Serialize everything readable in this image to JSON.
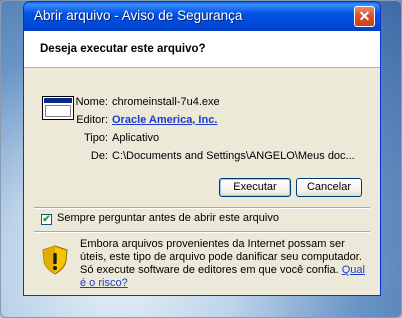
{
  "window": {
    "title": "Abrir arquivo - Aviso de Segurança",
    "close_symbol": "✕"
  },
  "header": {
    "question": "Deseja executar este arquivo?"
  },
  "file_info": {
    "icon": "application-window-icon",
    "name_label": "Nome:",
    "name_value": "chromeinstall-7u4.exe",
    "publisher_label": "Editor:",
    "publisher_value": "Oracle America, Inc.",
    "type_label": "Tipo:",
    "type_value": "Aplicativo",
    "from_label": "De:",
    "from_value": "C:\\Documents and Settings\\ANGELO\\Meus doc..."
  },
  "buttons": {
    "run_label": "Executar",
    "cancel_label": "Cancelar"
  },
  "checkbox": {
    "label": "Sempre perguntar antes de abrir este arquivo",
    "checked": true,
    "check_symbol": "✔"
  },
  "warning": {
    "icon": "security-shield-warning-icon",
    "text": "Embora arquivos provenientes da Internet possam ser úteis, este tipo de arquivo pode danificar seu computador. Só execute software de editores em que você confia.",
    "risk_link": "Qual é o risco?"
  },
  "colors": {
    "titlebar": "#0054e3",
    "dialog_bg": "#ece9d8",
    "link": "#1f3cc8"
  }
}
